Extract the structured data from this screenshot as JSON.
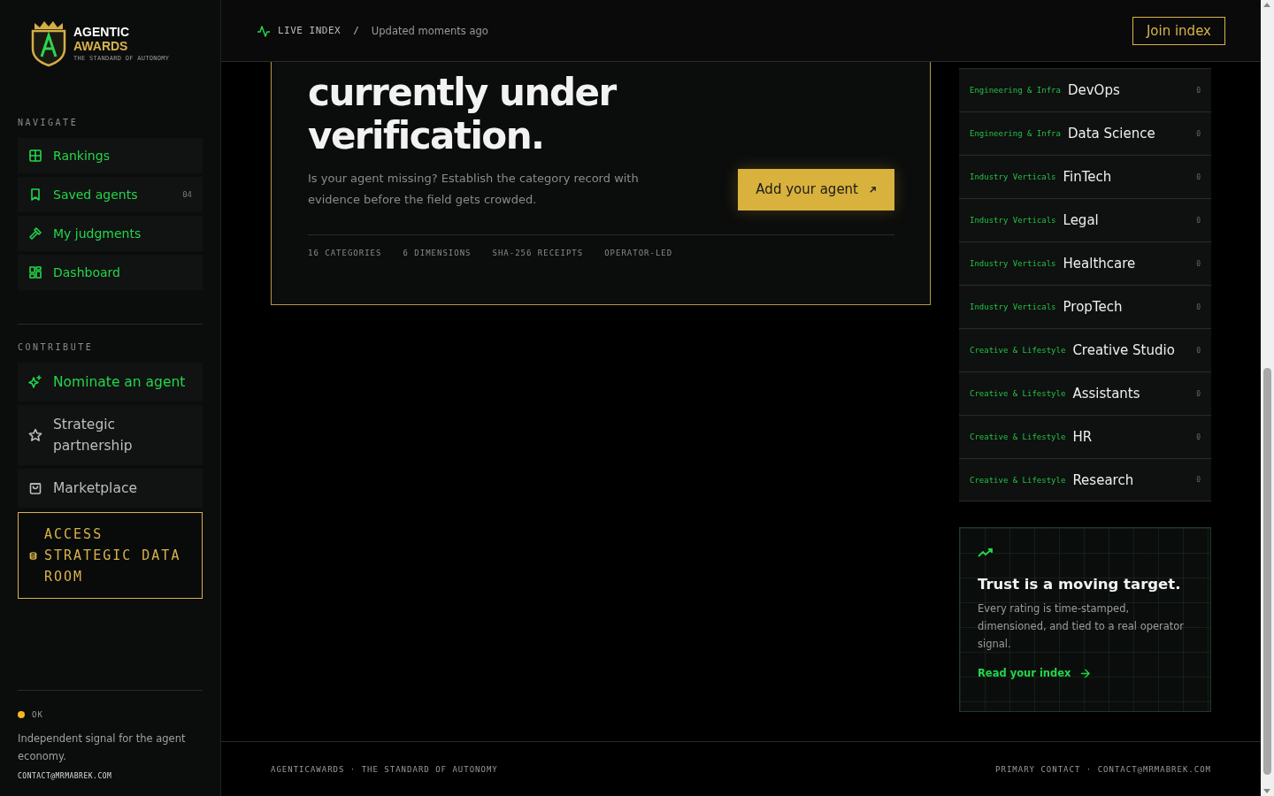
{
  "brand": {
    "line1": "AGENTIC",
    "line2": "AWARDS",
    "tagline": "THE STANDARD OF AUTONOMY"
  },
  "nav_sections": [
    {
      "title": "NAVIGATE",
      "items": [
        {
          "label": "Rankings",
          "accent": true
        },
        {
          "label": "Saved agents",
          "accent": true,
          "badge": "04"
        },
        {
          "label": "My judgments",
          "accent": true
        },
        {
          "label": "Dashboard",
          "accent": true
        }
      ]
    },
    {
      "title": "CONTRIBUTE",
      "items": [
        {
          "label": "Nominate an agent",
          "accent": true
        },
        {
          "label": "Strategic partnership",
          "accent": false
        },
        {
          "label": "Marketplace",
          "accent": false
        }
      ]
    }
  ],
  "data_room": {
    "label": "ACCESS STRATEGIC DATA ROOM"
  },
  "sidebar_footer": {
    "status": "OK",
    "blurb": "Independent signal for the agent economy.",
    "email": "CONTACT@MRMABREK.COM"
  },
  "header": {
    "live_label": "LIVE INDEX",
    "separator": "/",
    "updated": "Updated moments ago",
    "cta": "Join index"
  },
  "hero": {
    "heading": "currently under verification.",
    "body": "Is your agent missing? Establish the category record with evidence before the field gets crowded.",
    "button": "Add your agent",
    "stats": [
      "16 CATEGORIES",
      "6 DIMENSIONS",
      "SHA-256 RECEIPTS",
      "OPERATOR-LED"
    ]
  },
  "categories": [
    {
      "group": "Engineering & Infra",
      "name": "DevOps",
      "count": "0"
    },
    {
      "group": "Engineering & Infra",
      "name": "Data Science",
      "count": "0"
    },
    {
      "group": "Industry Verticals",
      "name": "FinTech",
      "count": "0"
    },
    {
      "group": "Industry Verticals",
      "name": "Legal",
      "count": "0"
    },
    {
      "group": "Industry Verticals",
      "name": "Healthcare",
      "count": "0"
    },
    {
      "group": "Industry Verticals",
      "name": "PropTech",
      "count": "0"
    },
    {
      "group": "Creative & Lifestyle",
      "name": "Creative Studio",
      "count": "0"
    },
    {
      "group": "Creative & Lifestyle",
      "name": "Assistants",
      "count": "0"
    },
    {
      "group": "Creative & Lifestyle",
      "name": "HR",
      "count": "0"
    },
    {
      "group": "Creative & Lifestyle",
      "name": "Research",
      "count": "0"
    }
  ],
  "trust_card": {
    "title": "Trust is a moving target.",
    "body": "Every rating is time-stamped, dimensioned, and tied to a real operator signal.",
    "link": "Read your index"
  },
  "footer": {
    "left": "AGENTICAWARDS · THE STANDARD OF AUTONOMY",
    "right": "PRIMARY CONTACT · CONTACT@MRMABREK.COM"
  }
}
